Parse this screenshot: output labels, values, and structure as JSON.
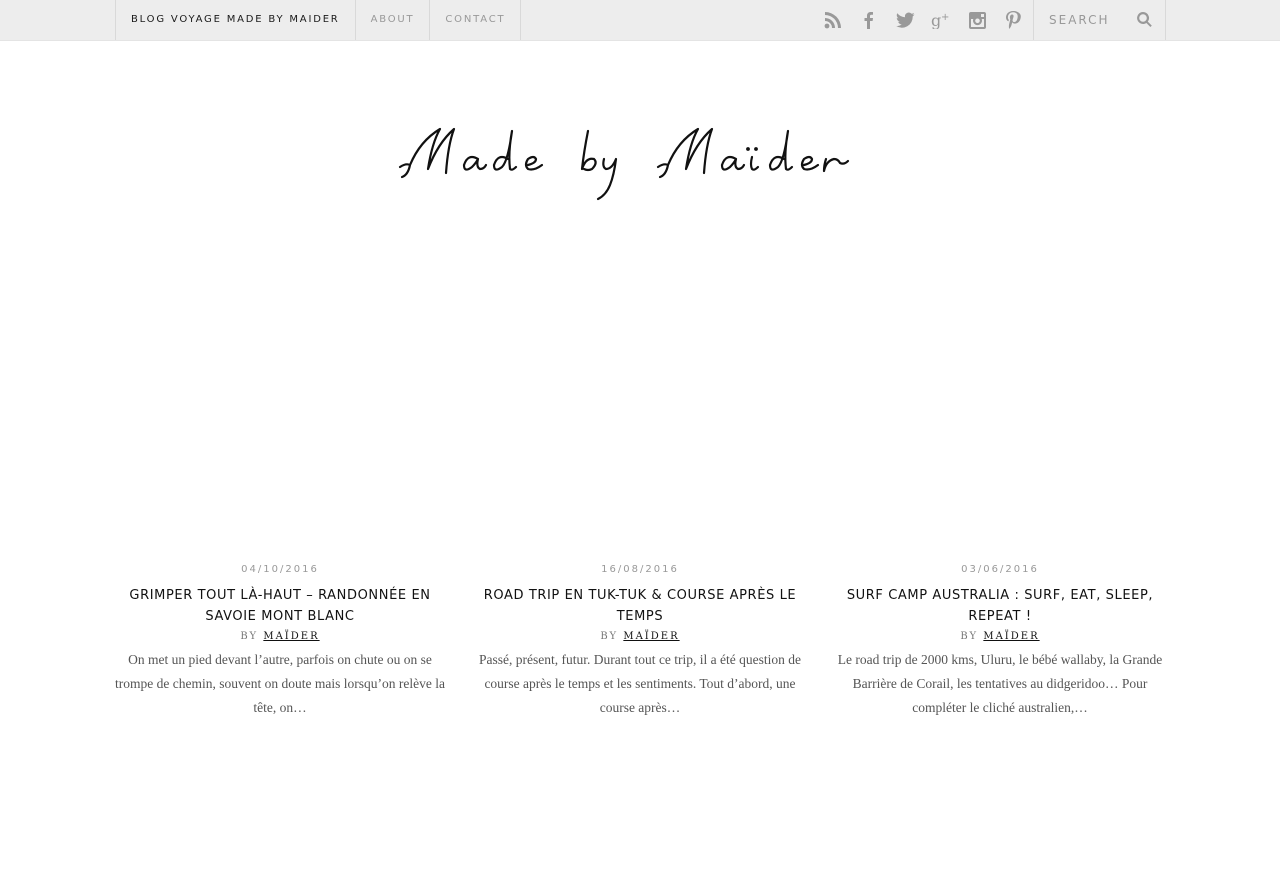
{
  "nav": {
    "brand": "BLOG VOYAGE MADE BY MAIDER",
    "about": "ABOUT",
    "contact": "CONTACT"
  },
  "social_icons": [
    "rss-icon",
    "facebook-icon",
    "twitter-icon",
    "google-plus-icon",
    "instagram-icon",
    "pinterest-icon"
  ],
  "search": {
    "placeholder": "SEARCH"
  },
  "logo": {
    "text": "Made by Maïder"
  },
  "posts": [
    {
      "date": "04/10/2016",
      "title": "GRIMPER TOUT LÀ-HAUT – RANDONNÉE EN SAVOIE MONT BLANC",
      "by": "BY",
      "author": "MAÏDER",
      "excerpt": "On met un pied devant l’autre, parfois on chute ou on se trompe de chemin, souvent on doute mais lorsqu’on relève la tête, on…"
    },
    {
      "date": "16/08/2016",
      "title": "ROAD TRIP EN TUK-TUK & COURSE APRÈS LE TEMPS",
      "by": "BY",
      "author": "MAÏDER",
      "excerpt": "Passé, présent, futur. Durant tout ce trip, il a été question de course après le temps et les sentiments. Tout d’abord, une course après…"
    },
    {
      "date": "03/06/2016",
      "title": "SURF CAMP AUSTRALIA : SURF, EAT, SLEEP, REPEAT !",
      "by": "BY",
      "author": "MAÏDER",
      "excerpt": "Le road trip de 2000 kms, Uluru, le bébé wallaby, la Grande Barrière de Corail, les tentatives au didgeridoo… Pour compléter le cliché australien,…"
    }
  ]
}
